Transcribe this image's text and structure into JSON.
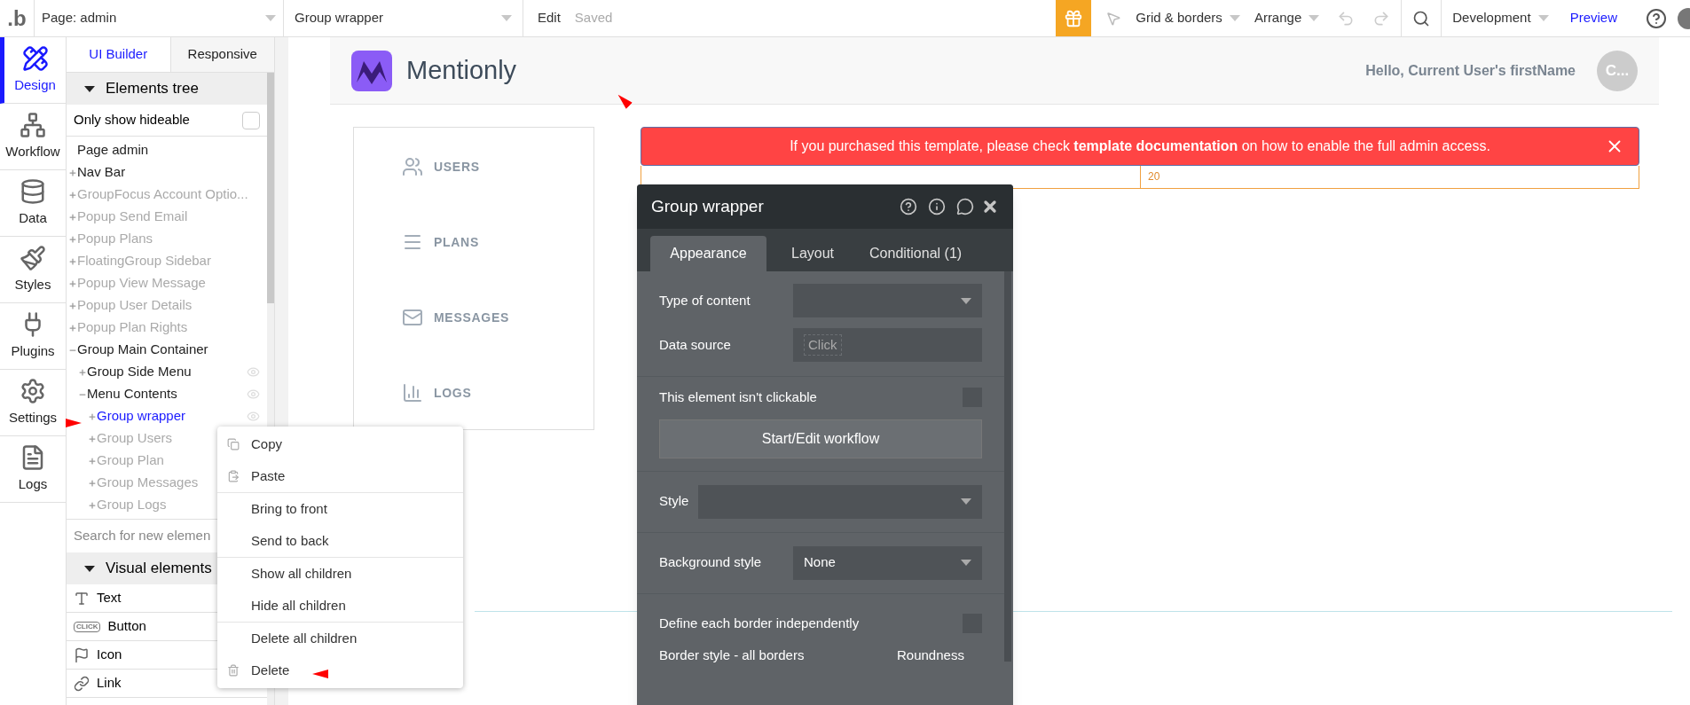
{
  "top_bar": {
    "logo": ".b",
    "page_select": "Page: admin",
    "element_select": "Group wrapper",
    "edit": "Edit",
    "saved": "Saved",
    "grid": "Grid & borders",
    "arrange": "Arrange",
    "environment": "Development",
    "preview": "Preview"
  },
  "rail": [
    {
      "kind": "design",
      "label": "Design",
      "selected": true
    },
    {
      "kind": "workflow",
      "label": "Workflow",
      "selected": false
    },
    {
      "kind": "data",
      "label": "Data",
      "selected": false
    },
    {
      "kind": "styles",
      "label": "Styles",
      "selected": false
    },
    {
      "kind": "plugins",
      "label": "Plugins",
      "selected": false
    },
    {
      "kind": "settings",
      "label": "Settings",
      "selected": false
    },
    {
      "kind": "logs",
      "label": "Logs",
      "selected": false
    }
  ],
  "panel_tabs": [
    {
      "label": "UI Builder",
      "selected": true
    },
    {
      "label": "Responsive",
      "selected": false
    }
  ],
  "elements_tree": {
    "title": "Elements tree",
    "only_show_hideable": {
      "label": "Only show hideable",
      "checked": false
    },
    "tree": [
      {
        "label": "Page admin",
        "selected": false,
        "hidden": false,
        "children": [
          {
            "label": "Nav Bar",
            "selected": false,
            "hidden": false,
            "expanded": false
          },
          {
            "label": "GroupFocus Account Optio...",
            "selected": false,
            "hidden": true,
            "expanded": false
          },
          {
            "label": "Popup Send Email",
            "selected": false,
            "hidden": true,
            "expanded": false
          },
          {
            "label": "Popup Plans",
            "selected": false,
            "hidden": true,
            "expanded": false
          },
          {
            "label": "FloatingGroup Sidebar",
            "selected": false,
            "hidden": true,
            "expanded": false
          },
          {
            "label": "Popup View Message",
            "selected": false,
            "hidden": true,
            "expanded": false
          },
          {
            "label": "Popup User Details",
            "selected": false,
            "hidden": true,
            "expanded": false
          },
          {
            "label": "Popup Plan Rights",
            "selected": false,
            "hidden": true,
            "expanded": false
          },
          {
            "label": "Group Main Container",
            "selected": false,
            "hidden": false,
            "expanded": true,
            "children": [
              {
                "label": "Group Side Menu",
                "selected": false,
                "hidden": false,
                "expanded": false
              },
              {
                "label": "Menu Contents",
                "selected": false,
                "hidden": false,
                "expanded": true,
                "children": [
                  {
                    "label": "Group wrapper",
                    "selected": true,
                    "hidden": false,
                    "expanded": false
                  },
                  {
                    "label": "Group Users",
                    "selected": false,
                    "hidden": true,
                    "expanded": false
                  },
                  {
                    "label": "Group Plan",
                    "selected": false,
                    "hidden": true,
                    "expanded": false
                  },
                  {
                    "label": "Group Messages",
                    "selected": false,
                    "hidden": true,
                    "expanded": false
                  },
                  {
                    "label": "Group Logs",
                    "selected": false,
                    "hidden": true,
                    "expanded": false
                  }
                ]
              }
            ]
          }
        ]
      }
    ]
  },
  "search": {
    "placeholder": "Search for new elemen"
  },
  "visual_elements": {
    "title": "Visual elements",
    "items": [
      {
        "kind": "text",
        "label": "Text"
      },
      {
        "kind": "button",
        "label": "Button",
        "icon_text": "CLICK"
      },
      {
        "kind": "icon",
        "label": "Icon"
      },
      {
        "kind": "link",
        "label": "Link"
      }
    ]
  },
  "canvas": {
    "brand": "Mentionly",
    "greeting": "Hello, Current User's firstName",
    "avatar": "C...",
    "side_menu": [
      {
        "kind": "users",
        "label": "USERS"
      },
      {
        "kind": "plans",
        "label": "PLANS"
      },
      {
        "kind": "messages",
        "label": "MESSAGES"
      },
      {
        "kind": "logs",
        "label": "LOGS"
      }
    ],
    "banner": "If you purchased this template, please check **template documentation** on how to enable the full admin access.",
    "row_cell": "20"
  },
  "property_panel": {
    "title": "Group wrapper",
    "tabs": [
      {
        "label": "Appearance",
        "selected": true
      },
      {
        "label": "Layout",
        "selected": false
      },
      {
        "label": "Conditional (1)",
        "selected": false
      }
    ],
    "type_of_content": {
      "label": "Type of content"
    },
    "data_source": {
      "label": "Data source",
      "value": "Click"
    },
    "not_clickable": {
      "label": "This element isn't clickable",
      "checked": false
    },
    "workflow_button": "Start/Edit workflow",
    "style": {
      "label": "Style"
    },
    "background_style": {
      "label": "Background style",
      "value": "None"
    },
    "border_independent": {
      "label": "Define each border independently",
      "checked": false
    },
    "border_style_label": "Border style - all borders",
    "roundness_label": "Roundness"
  },
  "context_menu": [
    [
      {
        "kind": "copy",
        "label": "Copy"
      },
      {
        "kind": "paste",
        "label": "Paste"
      }
    ],
    [
      {
        "kind": "plain",
        "label": "Bring to front"
      },
      {
        "kind": "plain",
        "label": "Send to back"
      }
    ],
    [
      {
        "kind": "plain",
        "label": "Show all children"
      },
      {
        "kind": "plain",
        "label": "Hide all children"
      }
    ],
    [
      {
        "kind": "plain",
        "label": "Delete all children"
      },
      {
        "kind": "delete",
        "label": "Delete"
      }
    ]
  ]
}
